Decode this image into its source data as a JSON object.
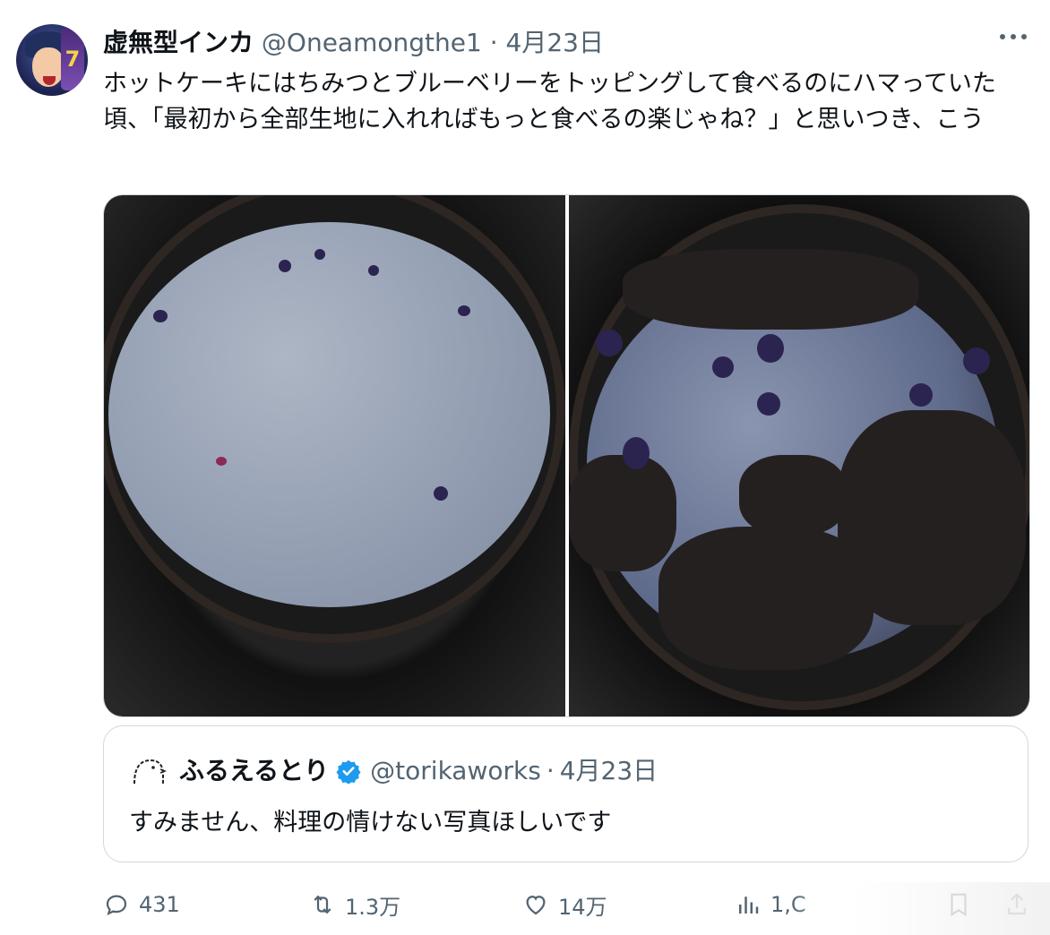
{
  "tweet": {
    "author_name": "虚無型インカ",
    "handle": "@Oneamongthe1",
    "separator": "·",
    "date": "4月23日",
    "avatar_badge": "7",
    "text": "ホットケーキにはちみつとブルーベリーをトッピングして食べるのにハマっていた頃、「最初から全部生地に入れればもっと食べるの楽じゃね？」と思いつき、こう"
  },
  "quote": {
    "author_name": "ふるえるとり",
    "handle": "@torikaworks",
    "separator": "·",
    "date": "4月23日",
    "text": "すみません、料理の情けない写真ほしいです",
    "verified_color": "#1d9bf0"
  },
  "actions": {
    "replies": "431",
    "retweets": "1.3万",
    "likes": "14万",
    "views": "1,C"
  },
  "icons": [
    "more-icon",
    "reply-icon",
    "retweet-icon",
    "like-icon",
    "views-icon",
    "bookmark-icon",
    "share-icon",
    "verified-icon"
  ]
}
